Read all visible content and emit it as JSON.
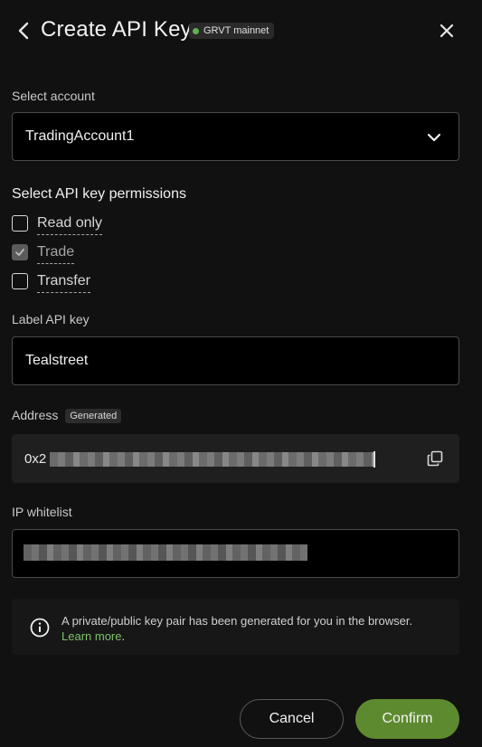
{
  "header": {
    "title": "Create API Key",
    "network_badge": "GRVT mainnet",
    "network_color": "#5fb34f"
  },
  "account": {
    "label": "Select account",
    "value": "TradingAccount1"
  },
  "permissions": {
    "title": "Select API key permissions",
    "items": [
      {
        "label": "Read only",
        "checked": false
      },
      {
        "label": "Trade",
        "checked": true
      },
      {
        "label": "Transfer",
        "checked": false
      }
    ]
  },
  "api_label": {
    "label": "Label API key",
    "value": "Tealstreet"
  },
  "address": {
    "label": "Address",
    "badge": "Generated",
    "prefix": "0x2"
  },
  "ip_whitelist": {
    "label": "IP whitelist"
  },
  "info": {
    "text": "A private/public key pair has been generated for you in the browser.",
    "link": "Learn more",
    "link_color": "#7fc26a"
  },
  "actions": {
    "cancel": "Cancel",
    "confirm": "Confirm",
    "confirm_color": "#5d8a2e"
  }
}
